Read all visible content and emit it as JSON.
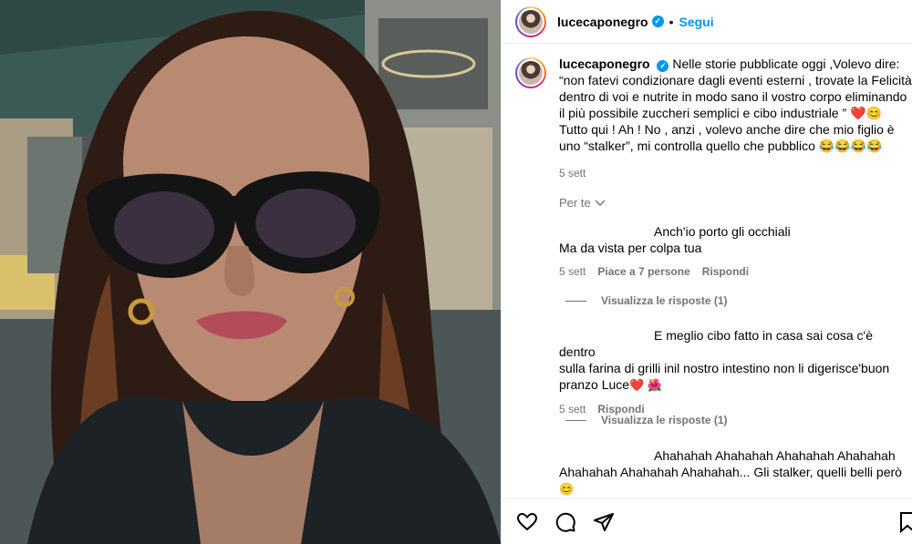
{
  "post": {
    "username": "lucecaponegro",
    "verified_glyph": "✓",
    "separator": "•",
    "follow_label": "Segui",
    "more_icon": "more-horizontal-icon"
  },
  "caption": {
    "username": "lucecaponegro",
    "text": "Nelle storie pubblicate oggi ,Volevo dire: “non fatevi condizionare dagli eventi esterni , trovate la Felicità dentro di voi e nutrite in modo sano il vostro corpo eliminando il più possibile zuccheri semplici e cibo industriale ” ❤️😊 Tutto qui ! Ah ! No , anzi , volevo anche dire che mio figlio è uno “stalker”, mi controlla quello che pubblico 😂😂😂😂",
    "time": "5 sett"
  },
  "translate_label": "Per te",
  "comments": [
    {
      "line1": "Anch'io porto gli occhiali",
      "line2": "Ma da vista per colpa tua",
      "time": "5 sett",
      "likes": "Piace a 7 persone",
      "reply": "Rispondi",
      "view_replies": "Visualizza le risposte (1)"
    },
    {
      "line1": "E meglio cibo fatto in casa sai cosa c'è dentro",
      "line2": "sulla farina di grilli inil nostro intestino non li digerisce'buon pranzo Luce",
      "emoji": "❤️ 🌺",
      "time": "5 sett",
      "reply": "Rispondi",
      "view_replies": "Visualizza le risposte (1)"
    },
    {
      "line1": "Ahahahah Ahahahah Ahahahah Ahahahah",
      "line2": "Ahahahah Ahahahah Ahahahah... Gli stalker, quelli belli però",
      "emoji": "😊"
    }
  ],
  "actions": [
    "heart-icon",
    "comment-icon",
    "share-icon",
    "bookmark-icon"
  ]
}
